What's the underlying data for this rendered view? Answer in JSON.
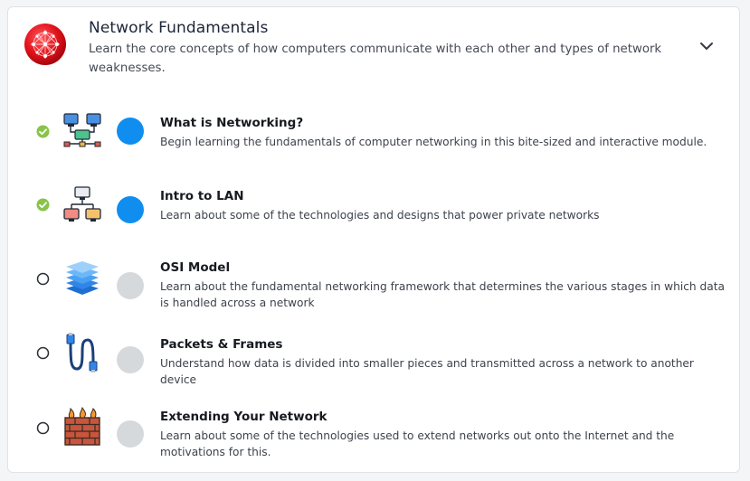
{
  "module": {
    "title": "Network Fundamentals",
    "description": "Learn the core concepts of how computers communicate with each other and types of network weaknesses.",
    "logo_icon": "red-network-globe-icon",
    "toggle_icon": "chevron-down-icon"
  },
  "rooms": [
    {
      "title": "What is Networking?",
      "description": "Begin learning the fundamentals of computer networking in this bite-sized and interactive module.",
      "completed": true,
      "icon": "networked-computers-icon"
    },
    {
      "title": "Intro to LAN",
      "description": "Learn about some of the technologies and designs that power private networks",
      "completed": true,
      "icon": "lan-topology-icon"
    },
    {
      "title": "OSI Model",
      "description": "Learn about the fundamental networking framework that determines the various stages in which data is handled across a network",
      "completed": false,
      "icon": "layer-stack-icon"
    },
    {
      "title": "Packets & Frames",
      "description": "Understand how data is divided into smaller pieces and transmitted across a network to another device",
      "completed": false,
      "icon": "ethernet-cable-icon"
    },
    {
      "title": "Extending Your Network",
      "description": "Learn about some of the technologies used to extend networks out onto the Internet and the motivations for this.",
      "completed": false,
      "icon": "firewall-icon"
    }
  ],
  "colors": {
    "completed_check": "#88c34a",
    "progress_done": "#0f8ef0",
    "progress_todo": "#d6d9dc"
  }
}
